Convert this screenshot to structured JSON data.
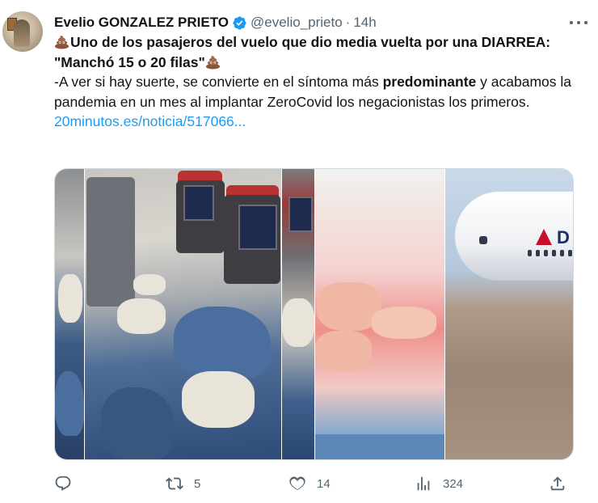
{
  "author": {
    "name": "Evelio GONZALEZ PRIETO",
    "handle": "@evelio_prieto",
    "separator": "·",
    "time": "14h"
  },
  "tweet": {
    "headline": "Uno de los pasajeros del vuelo que dio media vuelta por una DIARREA: \"Manchó 15 o 20 filas\"",
    "body_part1": "-A ver si hay suerte, se convierte en el síntoma más ",
    "body_bold": "predominante",
    "body_part2": " y acabamos la pandemia en un mes al implantar ZeroCovid los negacionistas los primeros.",
    "link": "20minutos.es/noticia/517066..."
  },
  "media": {
    "brand_text": "D"
  },
  "actions": {
    "replies": "",
    "retweets": "5",
    "likes": "14",
    "views": "324"
  },
  "icons": {
    "emoji": "pile-of-poo-icon",
    "verified": "verified-badge-icon",
    "more": "more-icon",
    "reply": "reply-icon",
    "retweet": "retweet-icon",
    "like": "heart-icon",
    "views": "views-icon",
    "share": "share-icon"
  },
  "colors": {
    "link": "#1d9bf0",
    "verified": "#1d9bf0",
    "meta": "#536471"
  }
}
